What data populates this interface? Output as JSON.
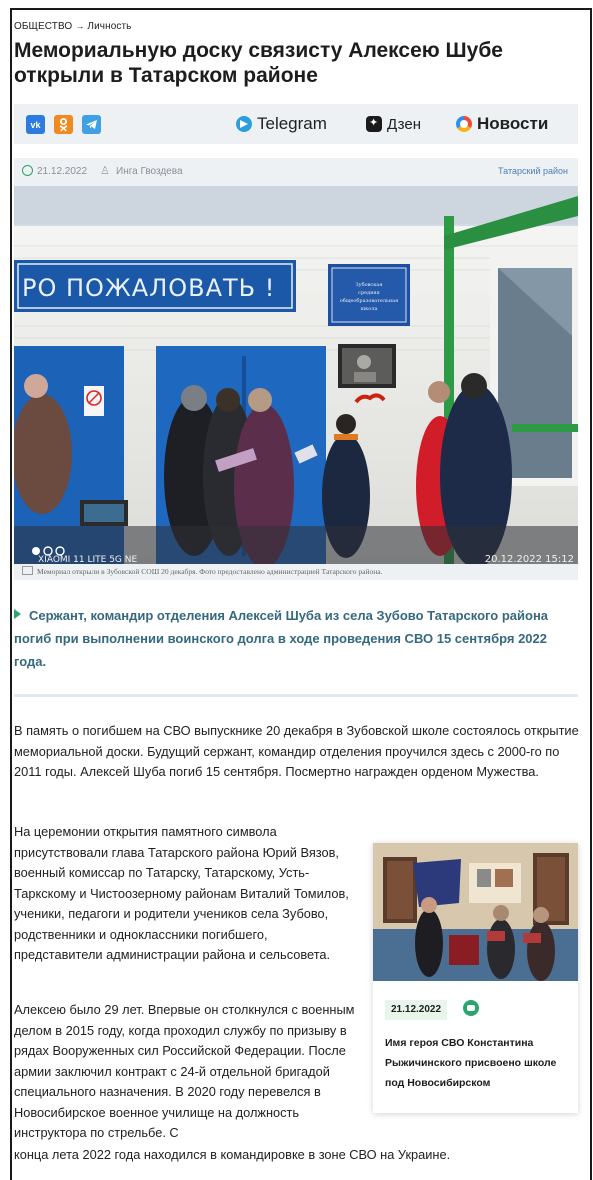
{
  "breadcrumb": {
    "section": "ОБЩЕСТВО",
    "separator": "→",
    "subsection": "Личность"
  },
  "article": {
    "title": "Мемориальную доску связисту Алексею Шубе открыли в Татарском районе",
    "date": "21.12.2022",
    "author": "Инга Гвоздева",
    "region": "Татарский район",
    "photo_caption": "Мемориал открыли в Зубовской СОШ 20 декабря. Фото предоставлено администрацией Татарского района.",
    "photo_sign": "ДОБРО ПОЖАЛОВАТЬ !",
    "photo_sign_visible": "РО ПОЖАЛОВАТЬ !",
    "plaque_text": "Зубовская средняя общеобразовательная школа",
    "photo_watermark_left": "XIAOMI 11 LITE 5G NE",
    "photo_watermark_right": "20.12.2022  15:12",
    "lead": "Сержант, командир отделения Алексей Шуба из села Зубово Татарского района погиб при выполнении воинского долга в ходе проведения СВО 15 сентября 2022 года.",
    "paragraphs": [
      "В память о погибшем на СВО выпускнике 20 декабря в Зубовской школе состоялось открытие мемориальной доски. Будущий сержант, командир отделения проучился здесь с 2000-го по 2011 годы. Алексей Шуба погиб 15 сентября. Посмертно награжден орденом Мужества.",
      "На церемонии открытия памятного символа присутствовали глава Татарского района Юрий Вязов, военный комиссар по Татарску, Татарскому, Усть-Таркскому и Чистоозерному районам Виталий Томилов, ученики, педагоги и родители учеников села Зубово, родственники и одноклассники погибшего, представители администрации района и сельсовета.",
      "Алексею было 29 лет. Впервые он столкнулся с военным делом в 2015 году, когда проходил службу по призыву в рядах Вооруженных сил Российской Федерации. После армии заключил контракт с 24-й отдельной бригадой специального назначения. В 2020 году перевелся в Новосибирское военное училище на должность инструктора по стрельбе. С",
      "конца лета 2022 года находился в командировке в зоне СВО на Украине."
    ]
  },
  "share": {
    "vk": "vk",
    "ok": "ok",
    "tg_icon": "telegram-plane-icon"
  },
  "partners": {
    "telegram": "Telegram",
    "dzen": "Дзен",
    "news": "Новости"
  },
  "related": {
    "date": "21.12.2022",
    "icon": "camera-icon",
    "title": "Имя героя СВО Константина Рыжичинского присвоено школе под Новосибирском"
  },
  "colors": {
    "accent_green": "#2aa56d",
    "lead_blue": "#356980",
    "bar_bg": "#edf1f4",
    "link_blue": "#4f7fb1"
  }
}
